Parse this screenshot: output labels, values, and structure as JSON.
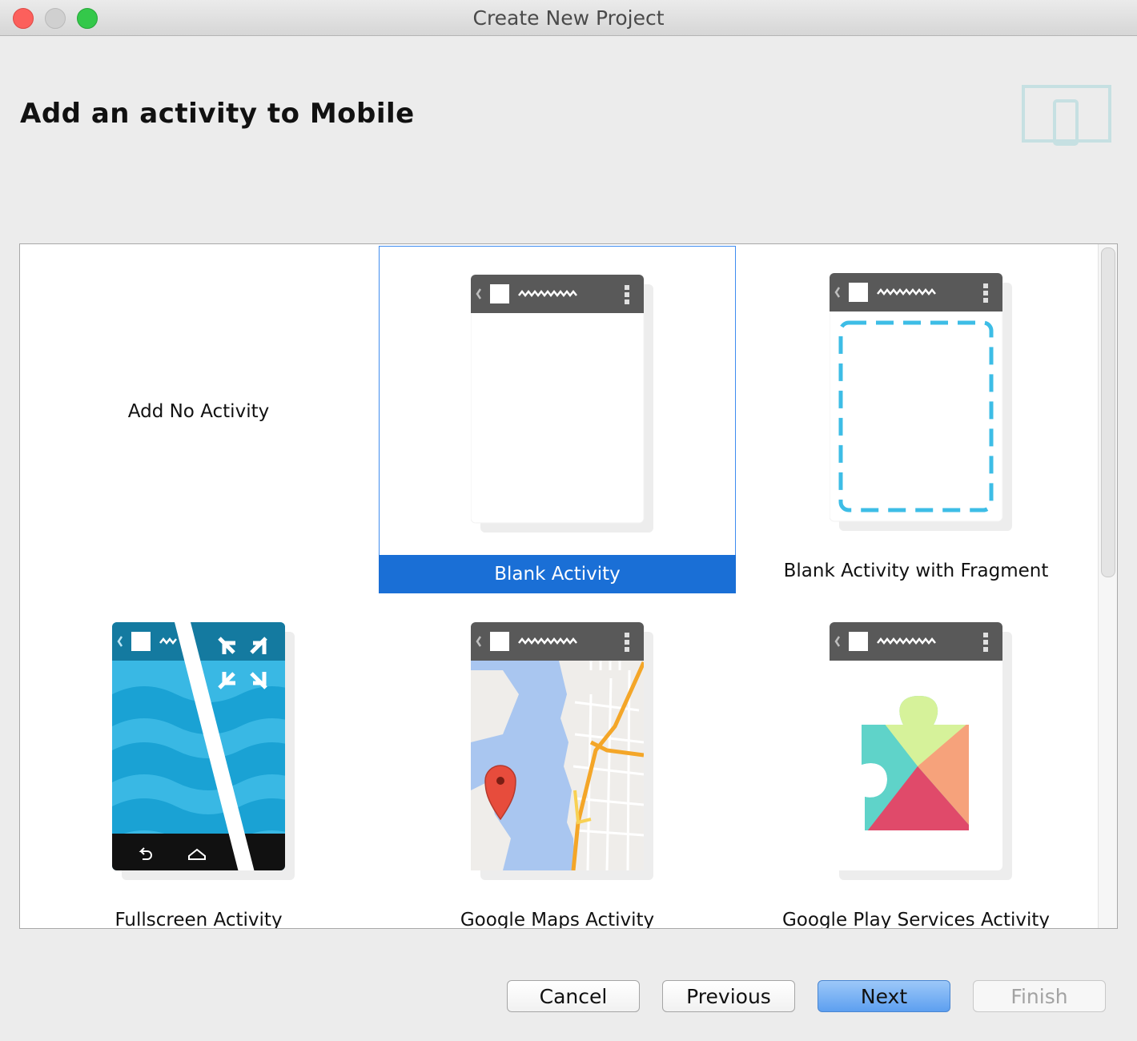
{
  "window": {
    "title": "Create New Project"
  },
  "header": {
    "title": "Add an activity to Mobile"
  },
  "gallery": {
    "items": [
      {
        "label": "Add No Activity",
        "selected": false
      },
      {
        "label": "Blank Activity",
        "selected": true
      },
      {
        "label": "Blank Activity with Fragment",
        "selected": false
      },
      {
        "label": "Fullscreen Activity",
        "selected": false
      },
      {
        "label": "Google Maps Activity",
        "selected": false
      },
      {
        "label": "Google Play Services Activity",
        "selected": false
      }
    ]
  },
  "buttons": {
    "cancel": "Cancel",
    "previous": "Previous",
    "next": "Next",
    "finish": "Finish"
  },
  "colors": {
    "selection": "#1a6fd6",
    "accent_dashed": "#3dbde6",
    "fullscreen_blue": "#1aa9dc"
  }
}
